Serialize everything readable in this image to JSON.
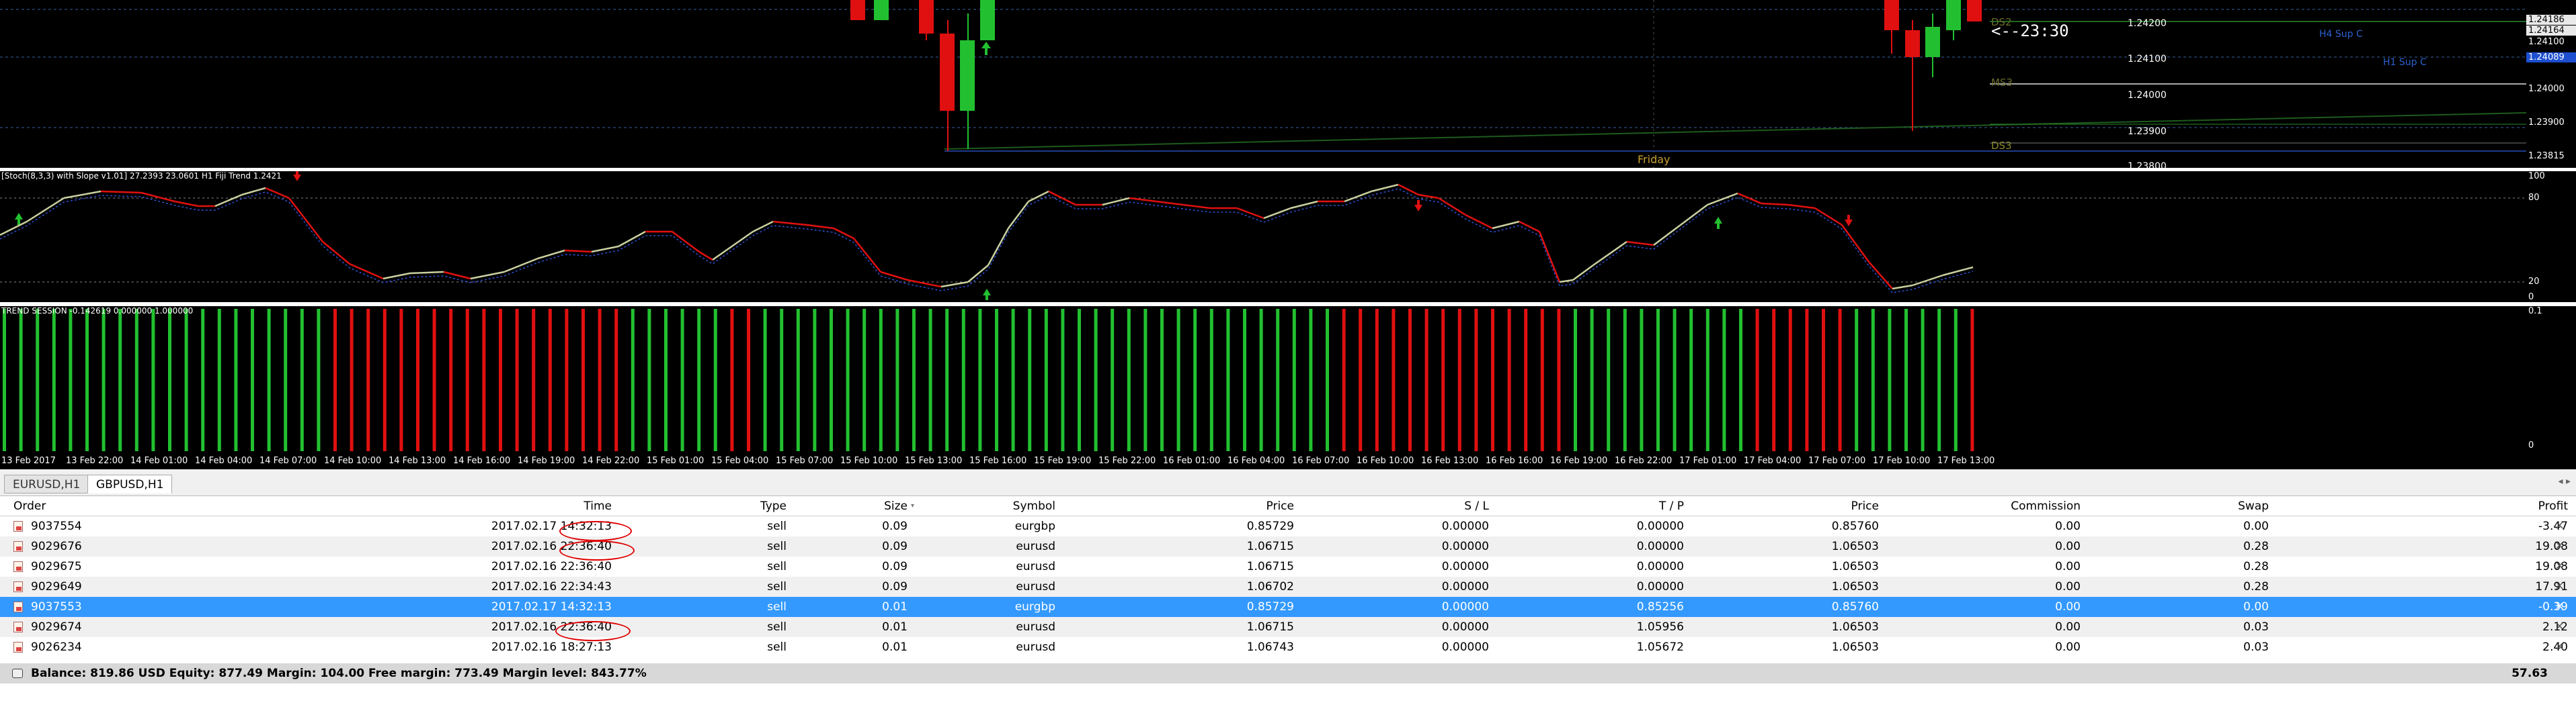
{
  "colors": {
    "bull": "#22c030",
    "bear": "#e01010",
    "chart_bg": "#000000",
    "selected_row": "#3399ff",
    "annotation": "#e00000"
  },
  "main_chart": {
    "countdown": "<--23:30",
    "day_label": "Friday",
    "levels": {
      "ds2": "DS2",
      "ms3": "MS3",
      "ds3": "DS3",
      "h4_sup": "H4 Sup C",
      "h1_sup": "H1 Sup C"
    },
    "price_axis": [
      "1.24200",
      "1.24100",
      "1.24000",
      "1.23900",
      "1.23815",
      "1.23800"
    ],
    "price_badges": [
      "1.24186",
      "1.24164",
      "1.24100",
      "1.24089"
    ],
    "icon_labels": [
      "up-arrow-icon"
    ]
  },
  "stoch": {
    "label": "[Stoch(8,3,3) with Slope v1.01] 27.2393 23.0601  H1 Fiji Trend 1.2421",
    "axis": [
      "100",
      "80",
      "20",
      "0"
    ]
  },
  "trend": {
    "label": "TREND SESSION -0.142619 0.000000 1.000000",
    "axis": [
      "0.1",
      "0"
    ]
  },
  "time_axis": [
    "13 Feb 2017",
    "13 Feb 22:00",
    "14 Feb 01:00",
    "14 Feb 04:00",
    "14 Feb 07:00",
    "14 Feb 10:00",
    "14 Feb 13:00",
    "14 Feb 16:00",
    "14 Feb 19:00",
    "14 Feb 22:00",
    "15 Feb 01:00",
    "15 Feb 04:00",
    "15 Feb 07:00",
    "15 Feb 10:00",
    "15 Feb 13:00",
    "15 Feb 16:00",
    "15 Feb 19:00",
    "15 Feb 22:00",
    "16 Feb 01:00",
    "16 Feb 04:00",
    "16 Feb 07:00",
    "16 Feb 10:00",
    "16 Feb 13:00",
    "16 Feb 16:00",
    "16 Feb 19:00",
    "16 Feb 22:00",
    "17 Feb 01:00",
    "17 Feb 04:00",
    "17 Feb 07:00",
    "17 Feb 10:00",
    "17 Feb 13:00"
  ],
  "tabs": [
    "EURUSD,H1",
    "GBPUSD,H1"
  ],
  "table": {
    "columns": {
      "order": "Order",
      "time": "Time",
      "type": "Type",
      "size": "Size",
      "symbol": "Symbol",
      "price": "Price",
      "sl": "S / L",
      "tp": "T / P",
      "price2": "Price",
      "commission": "Commission",
      "swap": "Swap",
      "profit": "Profit"
    },
    "rows": [
      {
        "order": "9037554",
        "time": "2017.02.17 14:32:13",
        "type": "sell",
        "size": "0.09",
        "symbol": "eurgbp",
        "price": "0.85729",
        "sl": "0.00000",
        "tp": "0.00000",
        "price2": "0.85760",
        "commission": "0.00",
        "swap": "0.00",
        "profit": "-3.47"
      },
      {
        "order": "9029676",
        "time": "2017.02.16 22:36:40",
        "type": "sell",
        "size": "0.09",
        "symbol": "eurusd",
        "price": "1.06715",
        "sl": "0.00000",
        "tp": "0.00000",
        "price2": "1.06503",
        "commission": "0.00",
        "swap": "0.28",
        "profit": "19.08"
      },
      {
        "order": "9029675",
        "time": "2017.02.16 22:36:40",
        "type": "sell",
        "size": "0.09",
        "symbol": "eurusd",
        "price": "1.06715",
        "sl": "0.00000",
        "tp": "0.00000",
        "price2": "1.06503",
        "commission": "0.00",
        "swap": "0.28",
        "profit": "19.08"
      },
      {
        "order": "9029649",
        "time": "2017.02.16 22:34:43",
        "type": "sell",
        "size": "0.09",
        "symbol": "eurusd",
        "price": "1.06702",
        "sl": "0.00000",
        "tp": "0.00000",
        "price2": "1.06503",
        "commission": "0.00",
        "swap": "0.28",
        "profit": "17.91"
      },
      {
        "order": "9037553",
        "time": "2017.02.17 14:32:13",
        "type": "sell",
        "size": "0.01",
        "symbol": "eurgbp",
        "price": "0.85729",
        "sl": "0.00000",
        "tp": "0.85256",
        "price2": "0.85760",
        "commission": "0.00",
        "swap": "0.00",
        "profit": "-0.39"
      },
      {
        "order": "9029674",
        "time": "2017.02.16 22:36:40",
        "type": "sell",
        "size": "0.01",
        "symbol": "eurusd",
        "price": "1.06715",
        "sl": "0.00000",
        "tp": "1.05956",
        "price2": "1.06503",
        "commission": "0.00",
        "swap": "0.03",
        "profit": "2.12"
      },
      {
        "order": "9026234",
        "time": "2017.02.16 18:27:13",
        "type": "sell",
        "size": "0.01",
        "symbol": "eurusd",
        "price": "1.06743",
        "sl": "0.00000",
        "tp": "1.05672",
        "price2": "1.06503",
        "commission": "0.00",
        "swap": "0.03",
        "profit": "2.40"
      }
    ],
    "balance_text": "Balance: 819.86 USD  Equity: 877.49  Margin: 104.00  Free margin: 773.49  Margin level: 843.77%",
    "total_profit": "57.63"
  }
}
